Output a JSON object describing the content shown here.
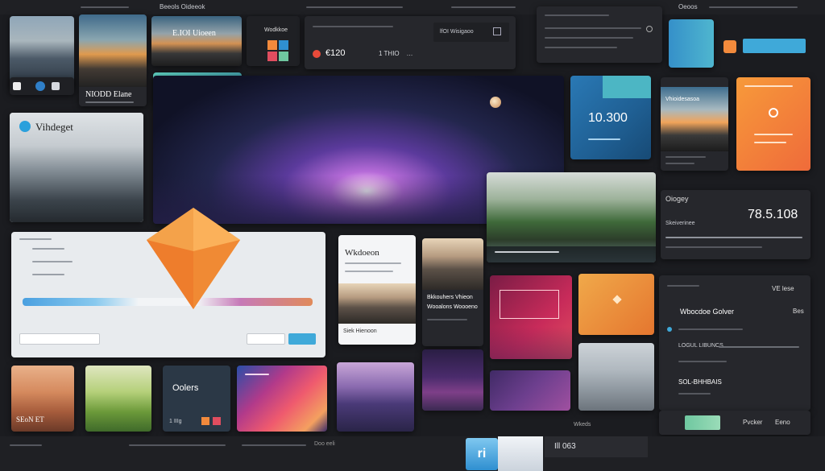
{
  "topbar": {
    "left_title": "Beeols Oideeok",
    "right_label": "Oeoos"
  },
  "cards": {
    "hero_title": "E.IOI Uioeen",
    "price_a": "€120",
    "value_b": "1 THIO    …",
    "value_b_sub": "lfOI Wisigaoo",
    "tag_c": "Wodkkoe",
    "big_title": "NIODD Elane",
    "widget_title": "Vihdeget",
    "metric_1": "10.300",
    "metric_2": "78.5.108",
    "metric_2_label": "Oiogey",
    "form_title": "Wkdoeon",
    "form_label_1": "Bkkouhers Vhieon",
    "form_label_2": "Wooalons Woooeno",
    "form_label_3": "Siek Hienoon",
    "sale_title": "Oolers",
    "sale_sub": "1 IIIg",
    "desert_label": "SEoN ET",
    "list_title": "Wbocdoe Golver",
    "list_item_1": "LOGUL LIBUNCS",
    "list_item_2": "SOL-BHHBAIS",
    "list_value": "Bes",
    "list_header": "VE  lese",
    "footer_label": "Pvcker",
    "footer_sub": "Eeno",
    "sunset_card_title": "Vhioidesasoa",
    "mini_stat": "Skeiverinee",
    "desktop_status": "Wkeds",
    "screen_bottom": "Doo eeli",
    "taskbar_glyph": "ri",
    "taskbar_time": "Ill 063"
  },
  "colors": {
    "accent": "#3fa9d9",
    "orange": "#f7943a",
    "background": "#1b1c20"
  },
  "icons": {
    "logo": "orange-gem-icon",
    "twitter": "bird-icon",
    "play": "play-icon"
  }
}
